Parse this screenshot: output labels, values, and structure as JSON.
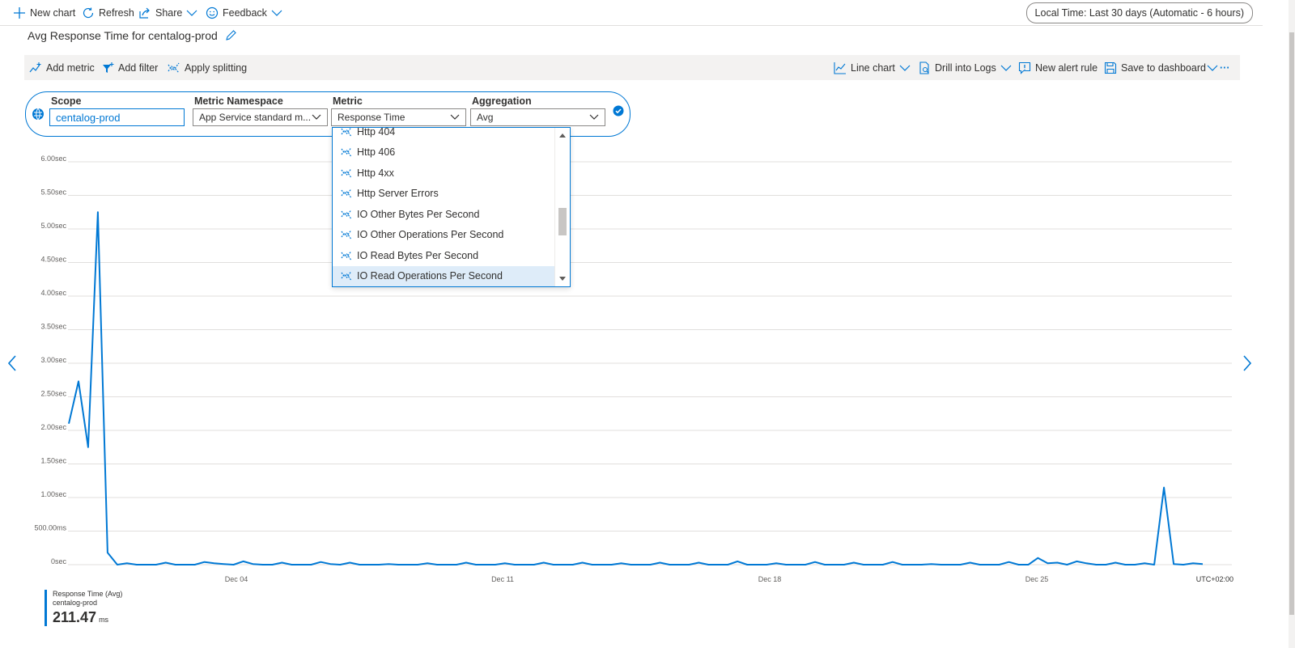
{
  "topbar": {
    "new_chart": "New chart",
    "refresh": "Refresh",
    "share": "Share",
    "feedback": "Feedback",
    "time_range": "Local Time: Last 30 days (Automatic - 6 hours)"
  },
  "chart_title": "Avg Response Time for centalog-prod",
  "toolbar": {
    "add_metric": "Add metric",
    "add_filter": "Add filter",
    "apply_splitting": "Apply splitting",
    "line_chart": "Line chart",
    "drill_logs": "Drill into Logs",
    "new_alert": "New alert rule",
    "save_dashboard": "Save to dashboard",
    "more": "···"
  },
  "picker": {
    "scope_label": "Scope",
    "scope_value": "centalog-prod",
    "namespace_label": "Metric Namespace",
    "namespace_value": "App Service standard m...",
    "metric_label": "Metric",
    "metric_value": "Response Time",
    "aggregation_label": "Aggregation",
    "aggregation_value": "Avg"
  },
  "metric_dropdown": {
    "items": [
      "Http 404",
      "Http 406",
      "Http 4xx",
      "Http Server Errors",
      "IO Other Bytes Per Second",
      "IO Other Operations Per Second",
      "IO Read Bytes Per Second",
      "IO Read Operations Per Second"
    ],
    "selected_index": 7
  },
  "legend": {
    "series_name": "Response Time (Avg)",
    "resource": "centalog-prod",
    "value": "211.47",
    "unit": "ms"
  },
  "colors": {
    "accent": "#0078d4",
    "grid": "#e1dfdd",
    "toolbar_bg": "#f3f2f1"
  },
  "chart_data": {
    "type": "line",
    "title": "Avg Response Time for centalog-prod",
    "xlabel": "",
    "ylabel": "",
    "y_ticks": [
      "0sec",
      "500.00ms",
      "1.00sec",
      "1.50sec",
      "2.00sec",
      "2.50sec",
      "3.00sec",
      "3.50sec",
      "4.00sec",
      "4.50sec",
      "5.00sec",
      "5.50sec",
      "6.00sec"
    ],
    "ylim": [
      0,
      6
    ],
    "x_ticks": [
      "Dec 04",
      "Dec 11",
      "Dec 18",
      "Dec 25"
    ],
    "timezone_label": "UTC+02:00",
    "series": [
      {
        "name": "Response Time (Avg)",
        "color": "#0078d4",
        "values": [
          2.1,
          2.73,
          1.75,
          5.25,
          0.18,
          0.0,
          0.02,
          0.0,
          0.0,
          0.0,
          0.03,
          0.0,
          0.0,
          0.0,
          0.04,
          0.02,
          0.01,
          0.0,
          0.05,
          0.01,
          0.0,
          0.0,
          0.03,
          0.0,
          0.0,
          0.0,
          0.04,
          0.01,
          0.0,
          0.03,
          0.0,
          0.0,
          0.0,
          0.01,
          0.0,
          0.0,
          0.0,
          0.02,
          0.0,
          0.0,
          0.0,
          0.03,
          0.0,
          0.0,
          0.0,
          0.02,
          0.0,
          0.0,
          0.0,
          0.03,
          0.0,
          0.0,
          0.0,
          0.03,
          0.0,
          0.0,
          0.0,
          0.02,
          0.0,
          0.0,
          0.0,
          0.03,
          0.0,
          0.0,
          0.0,
          0.03,
          0.0,
          0.0,
          0.0,
          0.05,
          0.0,
          0.0,
          0.0,
          0.02,
          0.0,
          0.0,
          0.0,
          0.04,
          0.0,
          0.0,
          0.0,
          0.03,
          0.0,
          0.0,
          0.0,
          0.04,
          0.0,
          0.0,
          0.0,
          0.01,
          0.0,
          0.0,
          0.0,
          0.03,
          0.0,
          0.0,
          0.0,
          0.04,
          0.0,
          0.0,
          0.1,
          0.02,
          0.03,
          0.0,
          0.05,
          0.02,
          0.0,
          0.0,
          0.03,
          0.0,
          0.0,
          0.02,
          0.0,
          1.15,
          0.01,
          0.0,
          0.02,
          0.01
        ]
      }
    ],
    "grid": true,
    "legend_position": "bottom-left"
  }
}
